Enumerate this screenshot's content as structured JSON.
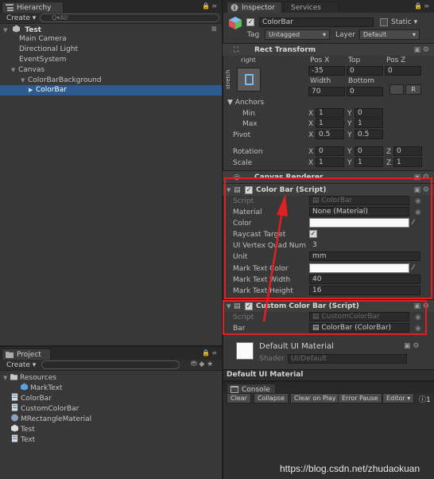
{
  "colors": {
    "accent_selection": "#2d5a8f",
    "annotation_red": "#e02020"
  },
  "hierarchy": {
    "tab_label": "Hierarchy",
    "create_label": "Create ▾",
    "search_placeholder": "Q▾All",
    "scene_name": "Test",
    "items": [
      "Main Camera",
      "Directional Light",
      "EventSystem",
      "Canvas",
      "ColorBarBackground",
      "ColorBar"
    ]
  },
  "project": {
    "tab_label": "Project",
    "create_label": "Create ▾",
    "items": [
      "Resources",
      "MarkText",
      "ColorBar",
      "CustomColorBar",
      "MRectangleMaterial",
      "Test",
      "Text"
    ]
  },
  "inspector": {
    "tab_inspector": "Inspector",
    "tab_services": "Services",
    "object_name": "ColorBar",
    "static_label": "Static ▾",
    "tag_label": "Tag",
    "tag_value": "Untagged",
    "layer_label": "Layer",
    "layer_value": "Default",
    "rect_transform": {
      "title": "Rect Transform",
      "anchor_top": "right",
      "anchor_side": "stretch",
      "pos_x_label": "Pos X",
      "top_label": "Top",
      "pos_z_label": "Pos Z",
      "pos_x": "-35",
      "top": "0",
      "pos_z": "0",
      "width_label": "Width",
      "bottom_label": "Bottom",
      "width": "70",
      "bottom": "0",
      "r_button": "R",
      "anchors_label": "Anchors",
      "min_label": "Min",
      "max_label": "Max",
      "min_x": "1",
      "min_y": "0",
      "max_x": "1",
      "max_y": "1",
      "pivot_label": "Pivot",
      "pivot_x": "0.5",
      "pivot_y": "0.5",
      "rotation_label": "Rotation",
      "rot_x": "0",
      "rot_y": "0",
      "rot_z": "0",
      "scale_label": "Scale",
      "scale_x": "1",
      "scale_y": "1",
      "scale_z": "1",
      "x": "X",
      "y": "Y",
      "z": "Z"
    },
    "canvas_renderer": "Canvas Renderer",
    "color_bar": {
      "title": "Color Bar (Script)",
      "script_label": "Script",
      "script_value": "ColorBar",
      "material_label": "Material",
      "material_value": "None (Material)",
      "color_label": "Color",
      "raycast_label": "Raycast Target",
      "quad_label": "UI Vertex Quad Num",
      "quad_value": "3",
      "unit_label": "Unit",
      "unit_value": "mm",
      "mark_color_label": "Mark Text Color",
      "mark_width_label": "Mark Text Width",
      "mark_width_value": "40",
      "mark_height_label": "Mark Text Height",
      "mark_height_value": "16"
    },
    "custom_color_bar": {
      "title": "Custom Color Bar (Script)",
      "script_label": "Script",
      "script_value": "CustomColorBar",
      "bar_label": "Bar",
      "bar_value": "ColorBar (ColorBar)"
    },
    "material": {
      "name": "Default UI Material",
      "shader_label": "Shader",
      "shader_value": "UI/Default"
    },
    "preview_label": "Default UI Material"
  },
  "console": {
    "tab_label": "Console",
    "buttons": [
      "Clear",
      "Collapse",
      "Clear on Play",
      "Error Pause",
      "Editor ▾"
    ],
    "info_count": "1"
  },
  "watermark": "https://blog.csdn.net/zhudaokuan"
}
